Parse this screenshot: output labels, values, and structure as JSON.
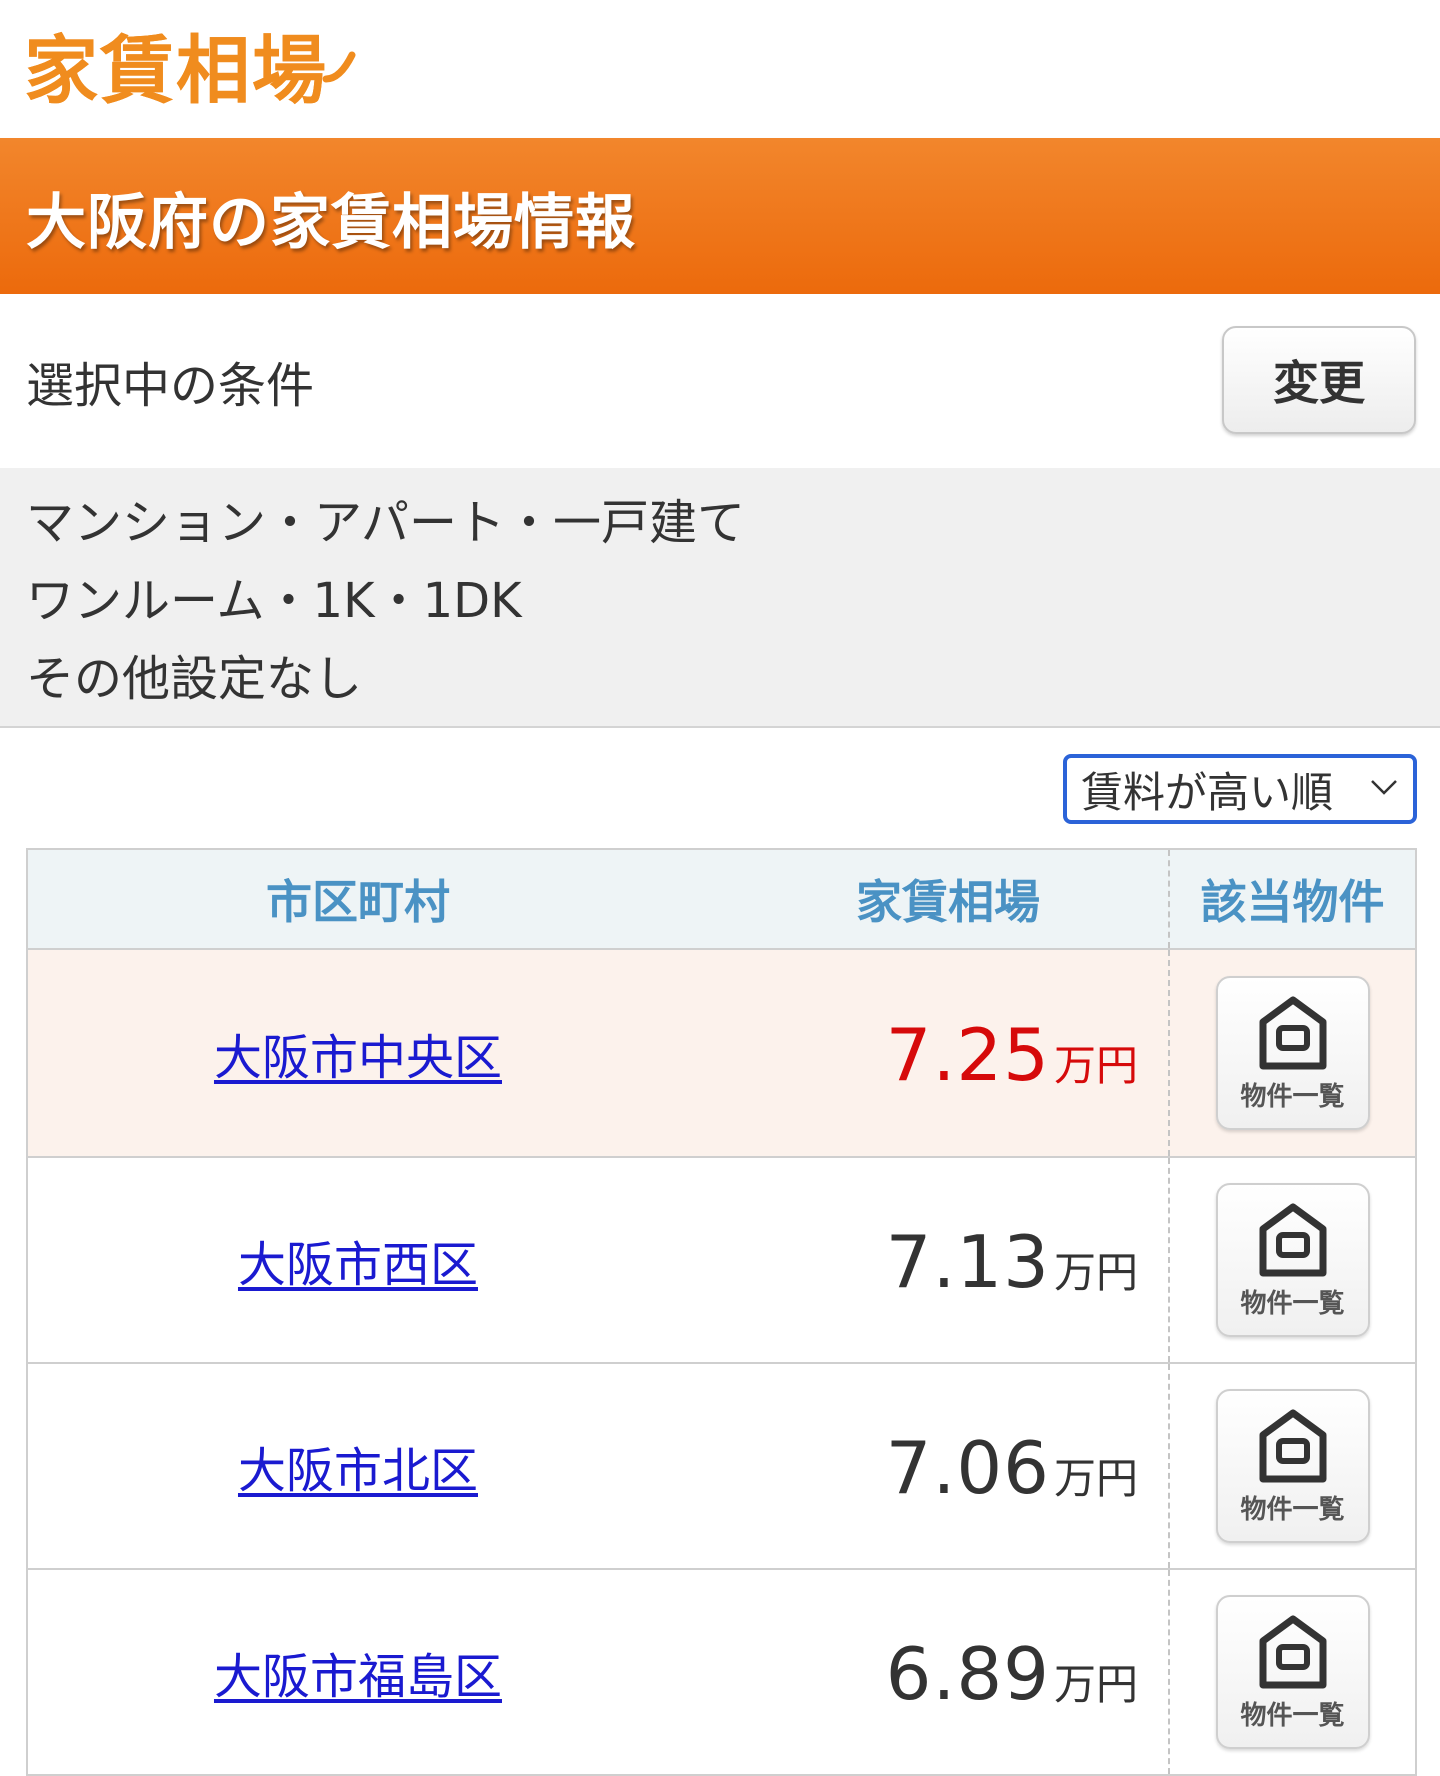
{
  "site": {
    "logo_text": "家賃相場",
    "brand_color": "#f08c1e"
  },
  "banner": {
    "title": "大阪府の家賃相場情報",
    "color": "#ee7518"
  },
  "conditions": {
    "label": "選択中の条件",
    "change_button": "変更",
    "lines": [
      "マンション・アパート・一戸建て",
      "ワンルーム・1K・1DK",
      "その他設定なし"
    ]
  },
  "sort": {
    "selected": "賃料が高い順",
    "icon": "chevron-down-icon"
  },
  "table": {
    "headers": {
      "area": "市区町村",
      "rent": "家賃相場",
      "listings": "該当物件"
    },
    "rows": [
      {
        "area": "大阪市中央区",
        "rent": "7.25",
        "unit": "万円",
        "listings_button": "物件一覧",
        "highlight": true
      },
      {
        "area": "大阪市西区",
        "rent": "7.13",
        "unit": "万円",
        "listings_button": "物件一覧",
        "highlight": false
      },
      {
        "area": "大阪市北区",
        "rent": "7.06",
        "unit": "万円",
        "listings_button": "物件一覧",
        "highlight": false
      },
      {
        "area": "大阪市福島区",
        "rent": "6.89",
        "unit": "万円",
        "listings_button": "物件一覧",
        "highlight": false
      }
    ],
    "highlight_color": "#d60a0a",
    "link_color": "#1a1ad0",
    "header_color": "#4a92c4"
  }
}
